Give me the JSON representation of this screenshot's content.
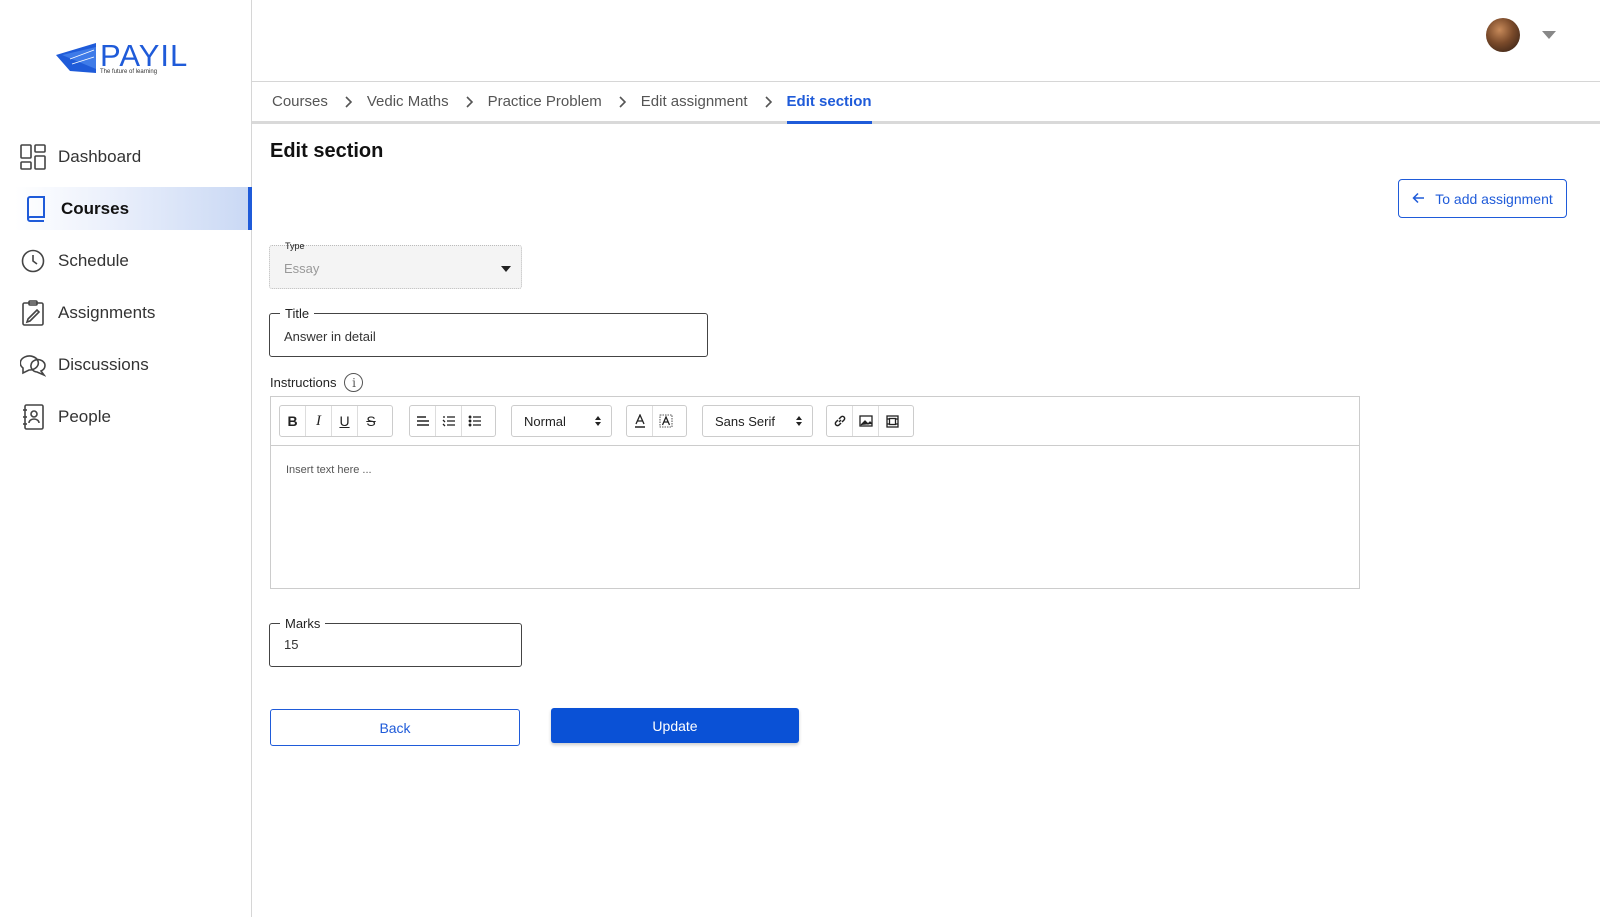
{
  "brand": {
    "name": "PAYIL",
    "tagline": "The future of learning",
    "color": "#1f5bd9"
  },
  "sidebar": {
    "items": [
      {
        "label": "Dashboard",
        "icon": "dashboard-icon"
      },
      {
        "label": "Courses",
        "icon": "book-icon",
        "active": true
      },
      {
        "label": "Schedule",
        "icon": "clock-icon"
      },
      {
        "label": "Assignments",
        "icon": "clipboard-icon"
      },
      {
        "label": "Discussions",
        "icon": "chat-icon"
      },
      {
        "label": "People",
        "icon": "contact-book-icon"
      }
    ]
  },
  "header": {
    "avatar": "user-avatar",
    "menu_icon": "caret-down-icon"
  },
  "breadcrumb": [
    "Courses",
    "Vedic Maths",
    "Practice Problem",
    "Edit assignment",
    "Edit section"
  ],
  "page": {
    "title": "Edit section",
    "to_add_label": "To add assignment"
  },
  "form": {
    "type": {
      "legend": "Type",
      "value": "Essay"
    },
    "title": {
      "legend": "Title",
      "value": "Answer in detail"
    },
    "instructions": {
      "label": "Instructions",
      "info_glyph": "i",
      "placeholder": "Insert text here ...",
      "toolbar": {
        "format": [
          "B",
          "I",
          "U",
          "S"
        ],
        "size": "Normal",
        "font": "Sans Serif"
      }
    },
    "marks": {
      "legend": "Marks",
      "value": "15"
    },
    "back_label": "Back",
    "update_label": "Update"
  },
  "colors": {
    "accent": "#1f5bd9",
    "primary_button": "#0a51d6",
    "active_nav": "#c9d8f4"
  }
}
